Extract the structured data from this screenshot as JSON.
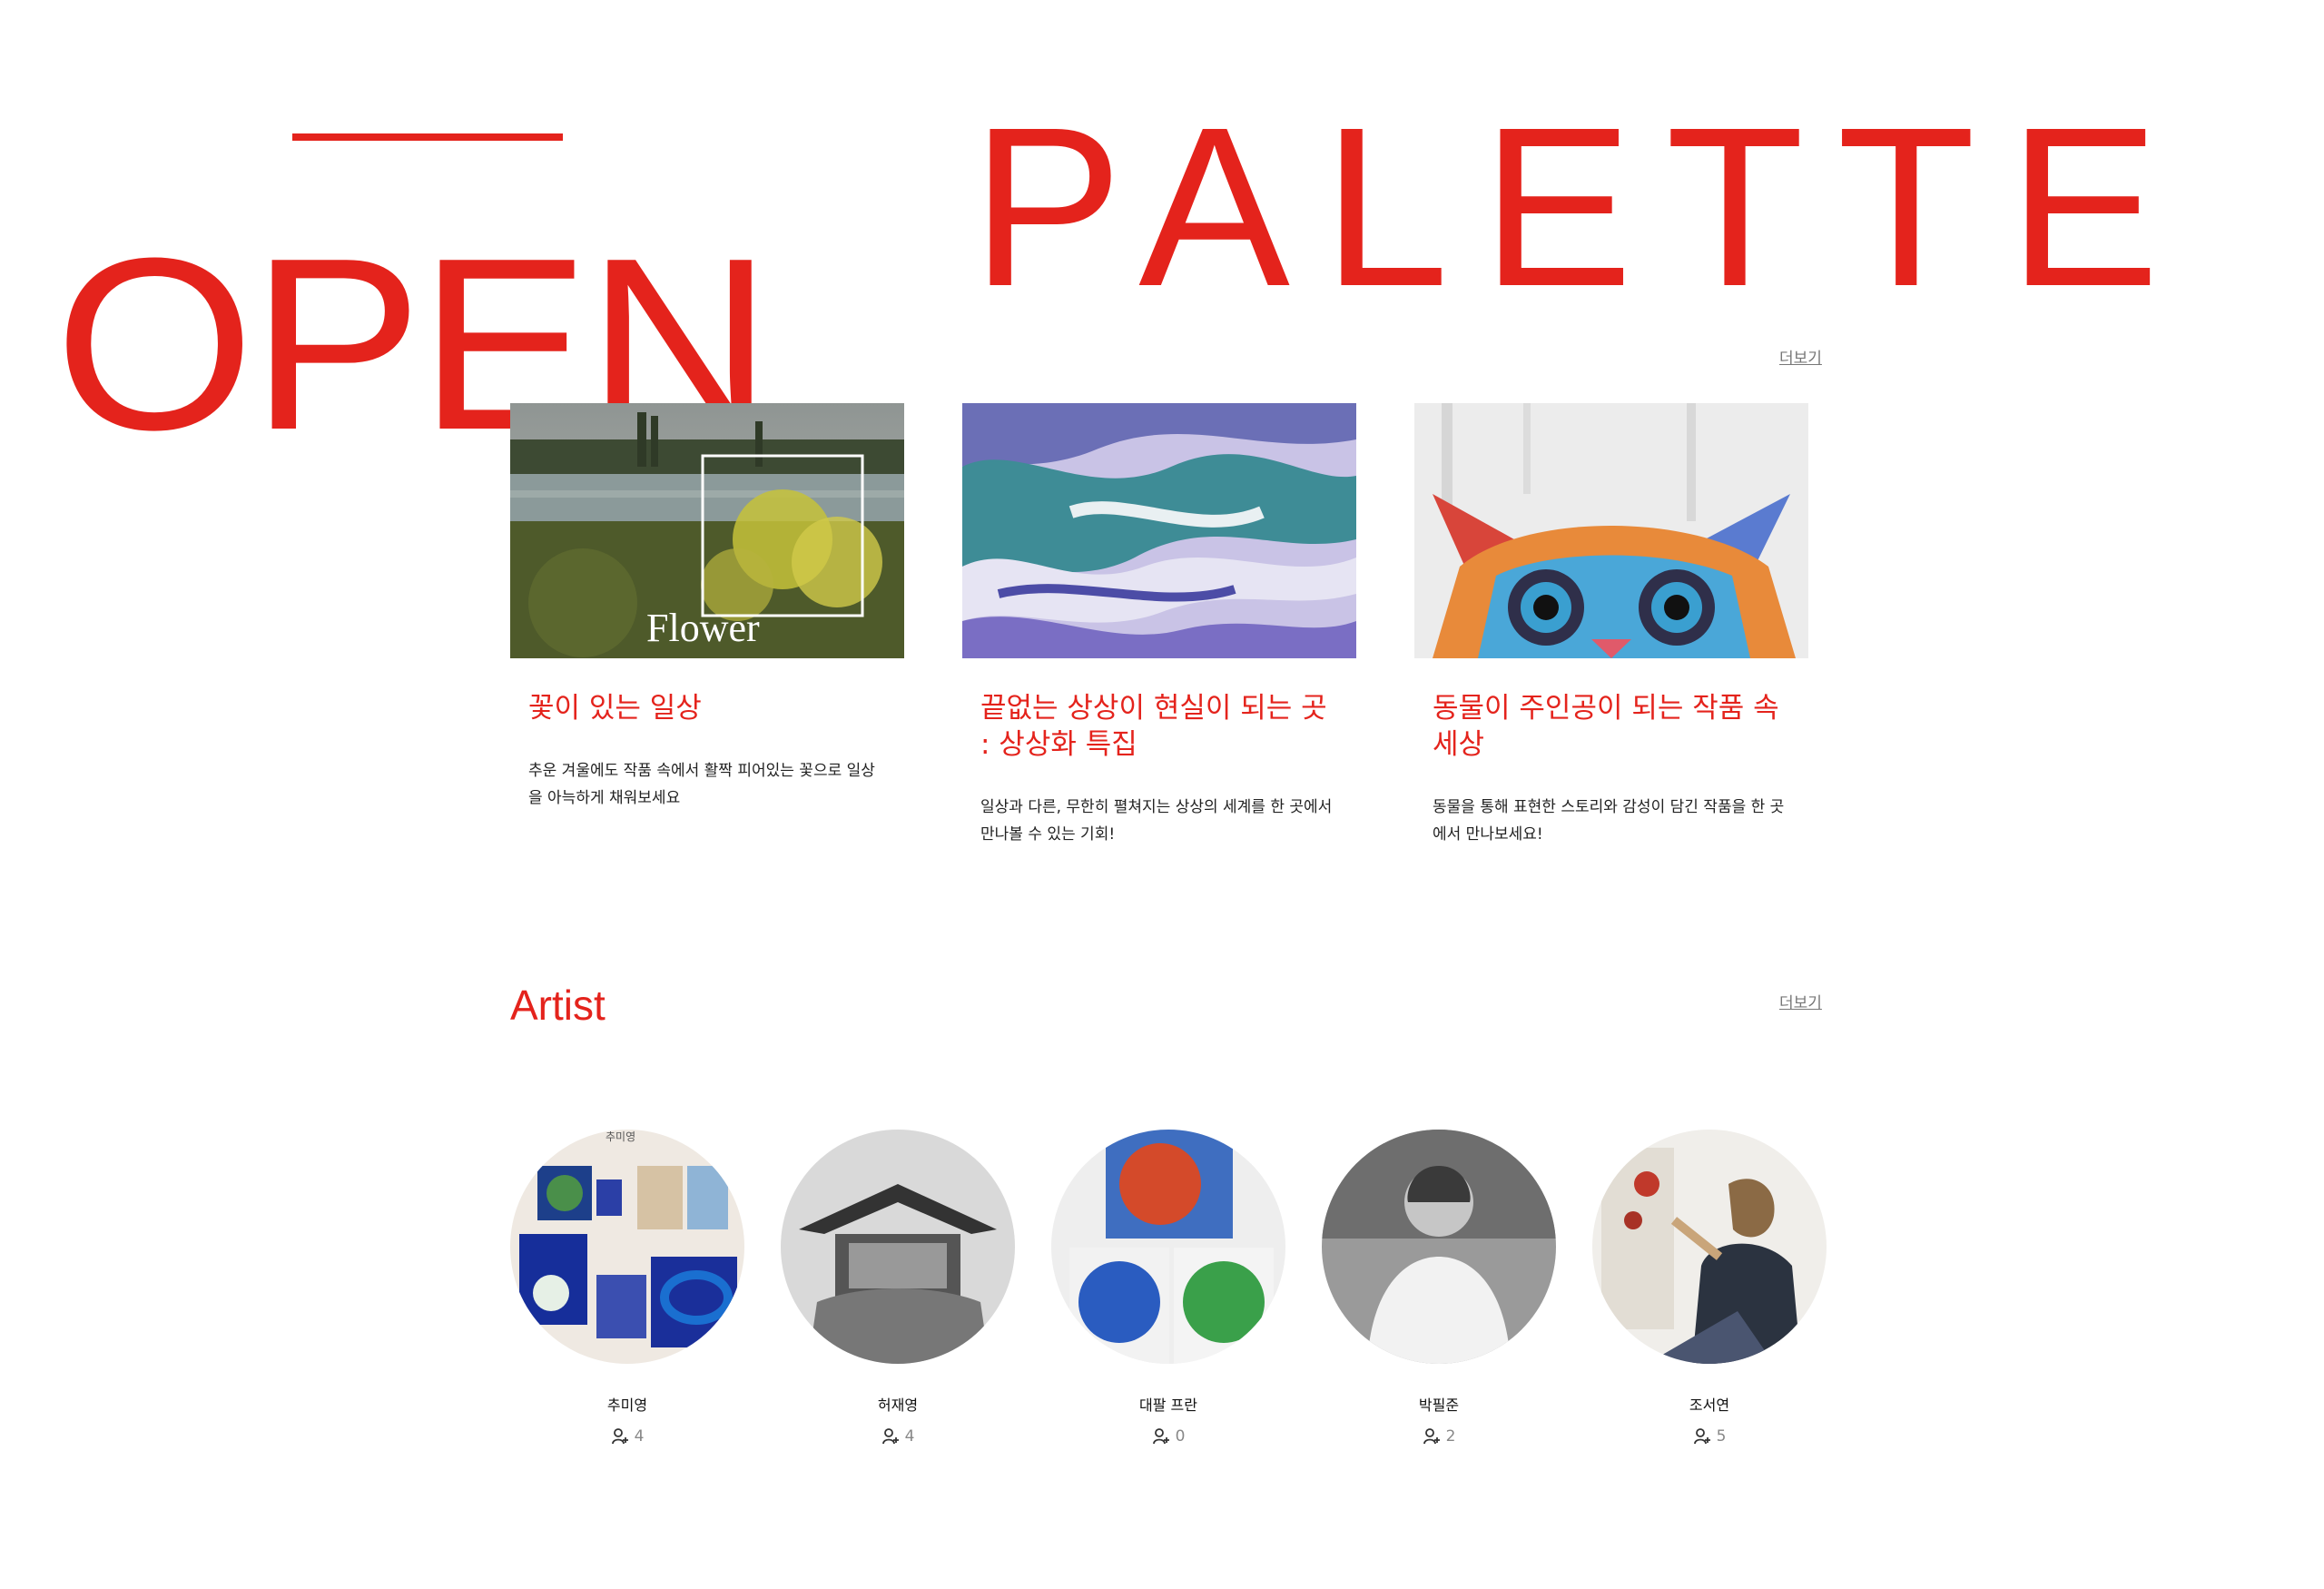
{
  "hero": {
    "word1": "OPEN",
    "word2": "PALETTE"
  },
  "brand_color": "#e4231c",
  "exhibitions": {
    "more_label": "더보기",
    "cards": [
      {
        "image_text": "Flower",
        "title": "꽃이 있는 일상",
        "description": "추운 겨울에도 작품 속에서 활짝 피어있는 꽃으로 일상을 아늑하게 채워보세요"
      },
      {
        "title": "끝없는 상상이 현실이 되는 곳 : 상상화 특집",
        "description": "일상과 다른, 무한히 펼쳐지는 상상의 세계를 한 곳에서 만나볼 수 있는 기회!"
      },
      {
        "title": "동물이 주인공이 되는 작품 속 세상",
        "description": "동물을 통해 표현한 스토리와 감성이 담긴 작품을 한 곳에서 만나보세요!"
      }
    ]
  },
  "artists": {
    "title": "Artist",
    "more_label": "더보기",
    "items": [
      {
        "name": "추미영",
        "followers": "4",
        "photo_label": "추미영"
      },
      {
        "name": "허재영",
        "followers": "4"
      },
      {
        "name": "대팔 프란",
        "followers": "0"
      },
      {
        "name": "박필준",
        "followers": "2"
      },
      {
        "name": "조서연",
        "followers": "5"
      }
    ],
    "follower_icon": "person-plus-icon"
  }
}
